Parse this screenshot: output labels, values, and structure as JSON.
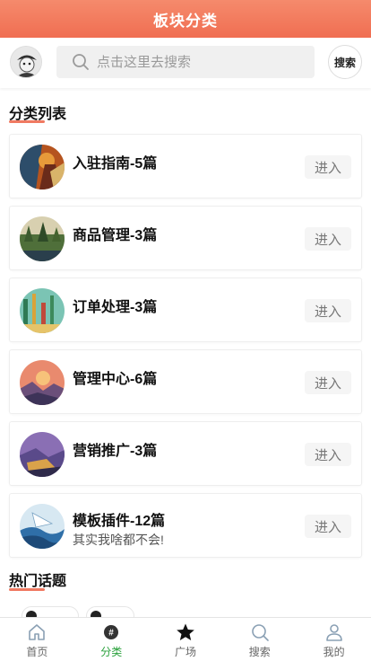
{
  "header": {
    "title": "板块分类"
  },
  "search": {
    "placeholder": "点击这里去搜索",
    "button_label": "搜索"
  },
  "categories_section": {
    "title": "分类列表"
  },
  "categories": [
    {
      "name": "入驻指南-5篇",
      "description": "",
      "action_label": "进入",
      "thumb": "thumb-1"
    },
    {
      "name": "商品管理-3篇",
      "description": "",
      "action_label": "进入",
      "thumb": "thumb-2"
    },
    {
      "name": "订单处理-3篇",
      "description": "",
      "action_label": "进入",
      "thumb": "thumb-3"
    },
    {
      "name": "管理中心-6篇",
      "description": "",
      "action_label": "进入",
      "thumb": "thumb-4"
    },
    {
      "name": "营销推广-3篇",
      "description": "",
      "action_label": "进入",
      "thumb": "thumb-5"
    },
    {
      "name": "模板插件-12篇",
      "description": "其实我啥都不会!",
      "action_label": "进入",
      "thumb": "thumb-6"
    }
  ],
  "hot_topics_section": {
    "title": "热门话题"
  },
  "tab_bar": {
    "items": [
      {
        "label": "首页",
        "icon": "home-icon",
        "active": false
      },
      {
        "label": "分类",
        "icon": "category-icon",
        "active": true
      },
      {
        "label": "广场",
        "icon": "star-icon",
        "active": false
      },
      {
        "label": "搜索",
        "icon": "search-icon",
        "active": false
      },
      {
        "label": "我的",
        "icon": "user-icon",
        "active": false
      }
    ]
  },
  "colors": {
    "header_gradient_top": "#f58a6c",
    "header_gradient_bottom": "#f06e52",
    "accent_underline": "#f07a62",
    "active_tab": "#2aa13c"
  }
}
